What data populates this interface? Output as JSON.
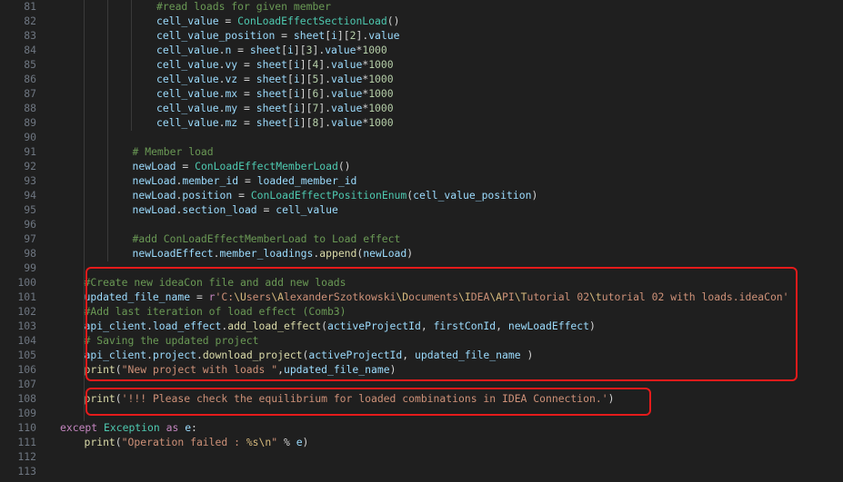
{
  "editor": {
    "lines": [
      {
        "n": "81",
        "indent": 4,
        "tokens": [
          {
            "t": "#read loads for given member",
            "c": "cmt"
          }
        ]
      },
      {
        "n": "82",
        "indent": 4,
        "tokens": [
          {
            "t": "cell_value",
            "c": "var"
          },
          {
            "t": " = ",
            "c": ""
          },
          {
            "t": "ConLoadEffectSectionLoad",
            "c": "cls"
          },
          {
            "t": "()",
            "c": ""
          }
        ]
      },
      {
        "n": "83",
        "indent": 4,
        "tokens": [
          {
            "t": "cell_value_position",
            "c": "var"
          },
          {
            "t": " = ",
            "c": ""
          },
          {
            "t": "sheet",
            "c": "var"
          },
          {
            "t": "[",
            "c": ""
          },
          {
            "t": "i",
            "c": "var"
          },
          {
            "t": "][",
            "c": ""
          },
          {
            "t": "2",
            "c": "num"
          },
          {
            "t": "].",
            "c": ""
          },
          {
            "t": "value",
            "c": "var"
          }
        ]
      },
      {
        "n": "84",
        "indent": 4,
        "tokens": [
          {
            "t": "cell_value",
            "c": "var"
          },
          {
            "t": ".",
            "c": ""
          },
          {
            "t": "n",
            "c": "var"
          },
          {
            "t": " = ",
            "c": ""
          },
          {
            "t": "sheet",
            "c": "var"
          },
          {
            "t": "[",
            "c": ""
          },
          {
            "t": "i",
            "c": "var"
          },
          {
            "t": "][",
            "c": ""
          },
          {
            "t": "3",
            "c": "num"
          },
          {
            "t": "].",
            "c": ""
          },
          {
            "t": "value",
            "c": "var"
          },
          {
            "t": "*",
            "c": ""
          },
          {
            "t": "1000",
            "c": "num"
          }
        ]
      },
      {
        "n": "85",
        "indent": 4,
        "tokens": [
          {
            "t": "cell_value",
            "c": "var"
          },
          {
            "t": ".",
            "c": ""
          },
          {
            "t": "vy",
            "c": "var"
          },
          {
            "t": " = ",
            "c": ""
          },
          {
            "t": "sheet",
            "c": "var"
          },
          {
            "t": "[",
            "c": ""
          },
          {
            "t": "i",
            "c": "var"
          },
          {
            "t": "][",
            "c": ""
          },
          {
            "t": "4",
            "c": "num"
          },
          {
            "t": "].",
            "c": ""
          },
          {
            "t": "value",
            "c": "var"
          },
          {
            "t": "*",
            "c": ""
          },
          {
            "t": "1000",
            "c": "num"
          }
        ]
      },
      {
        "n": "86",
        "indent": 4,
        "tokens": [
          {
            "t": "cell_value",
            "c": "var"
          },
          {
            "t": ".",
            "c": ""
          },
          {
            "t": "vz",
            "c": "var"
          },
          {
            "t": " = ",
            "c": ""
          },
          {
            "t": "sheet",
            "c": "var"
          },
          {
            "t": "[",
            "c": ""
          },
          {
            "t": "i",
            "c": "var"
          },
          {
            "t": "][",
            "c": ""
          },
          {
            "t": "5",
            "c": "num"
          },
          {
            "t": "].",
            "c": ""
          },
          {
            "t": "value",
            "c": "var"
          },
          {
            "t": "*",
            "c": ""
          },
          {
            "t": "1000",
            "c": "num"
          }
        ]
      },
      {
        "n": "87",
        "indent": 4,
        "tokens": [
          {
            "t": "cell_value",
            "c": "var"
          },
          {
            "t": ".",
            "c": ""
          },
          {
            "t": "mx",
            "c": "var"
          },
          {
            "t": " = ",
            "c": ""
          },
          {
            "t": "sheet",
            "c": "var"
          },
          {
            "t": "[",
            "c": ""
          },
          {
            "t": "i",
            "c": "var"
          },
          {
            "t": "][",
            "c": ""
          },
          {
            "t": "6",
            "c": "num"
          },
          {
            "t": "].",
            "c": ""
          },
          {
            "t": "value",
            "c": "var"
          },
          {
            "t": "*",
            "c": ""
          },
          {
            "t": "1000",
            "c": "num"
          }
        ]
      },
      {
        "n": "88",
        "indent": 4,
        "tokens": [
          {
            "t": "cell_value",
            "c": "var"
          },
          {
            "t": ".",
            "c": ""
          },
          {
            "t": "my",
            "c": "var"
          },
          {
            "t": " = ",
            "c": ""
          },
          {
            "t": "sheet",
            "c": "var"
          },
          {
            "t": "[",
            "c": ""
          },
          {
            "t": "i",
            "c": "var"
          },
          {
            "t": "][",
            "c": ""
          },
          {
            "t": "7",
            "c": "num"
          },
          {
            "t": "].",
            "c": ""
          },
          {
            "t": "value",
            "c": "var"
          },
          {
            "t": "*",
            "c": ""
          },
          {
            "t": "1000",
            "c": "num"
          }
        ]
      },
      {
        "n": "89",
        "indent": 4,
        "tokens": [
          {
            "t": "cell_value",
            "c": "var"
          },
          {
            "t": ".",
            "c": ""
          },
          {
            "t": "mz",
            "c": "var"
          },
          {
            "t": " = ",
            "c": ""
          },
          {
            "t": "sheet",
            "c": "var"
          },
          {
            "t": "[",
            "c": ""
          },
          {
            "t": "i",
            "c": "var"
          },
          {
            "t": "][",
            "c": ""
          },
          {
            "t": "8",
            "c": "num"
          },
          {
            "t": "].",
            "c": ""
          },
          {
            "t": "value",
            "c": "var"
          },
          {
            "t": "*",
            "c": ""
          },
          {
            "t": "1000",
            "c": "num"
          }
        ]
      },
      {
        "n": "90",
        "indent": 0,
        "tokens": []
      },
      {
        "n": "91",
        "indent": 3,
        "tokens": [
          {
            "t": "# Member load",
            "c": "cmt"
          }
        ]
      },
      {
        "n": "92",
        "indent": 3,
        "tokens": [
          {
            "t": "newLoad",
            "c": "var"
          },
          {
            "t": " = ",
            "c": ""
          },
          {
            "t": "ConLoadEffectMemberLoad",
            "c": "cls"
          },
          {
            "t": "()",
            "c": ""
          }
        ]
      },
      {
        "n": "93",
        "indent": 3,
        "tokens": [
          {
            "t": "newLoad",
            "c": "var"
          },
          {
            "t": ".",
            "c": ""
          },
          {
            "t": "member_id",
            "c": "var"
          },
          {
            "t": " = ",
            "c": ""
          },
          {
            "t": "loaded_member_id",
            "c": "var"
          }
        ]
      },
      {
        "n": "94",
        "indent": 3,
        "tokens": [
          {
            "t": "newLoad",
            "c": "var"
          },
          {
            "t": ".",
            "c": ""
          },
          {
            "t": "position",
            "c": "var"
          },
          {
            "t": " = ",
            "c": ""
          },
          {
            "t": "ConLoadEffectPositionEnum",
            "c": "cls"
          },
          {
            "t": "(",
            "c": ""
          },
          {
            "t": "cell_value_position",
            "c": "var"
          },
          {
            "t": ")",
            "c": ""
          }
        ]
      },
      {
        "n": "95",
        "indent": 3,
        "tokens": [
          {
            "t": "newLoad",
            "c": "var"
          },
          {
            "t": ".",
            "c": ""
          },
          {
            "t": "section_load",
            "c": "var"
          },
          {
            "t": " = ",
            "c": ""
          },
          {
            "t": "cell_value",
            "c": "var"
          }
        ]
      },
      {
        "n": "96",
        "indent": 0,
        "tokens": []
      },
      {
        "n": "97",
        "indent": 3,
        "tokens": [
          {
            "t": "#add ConLoadEffectMemberLoad to Load effect",
            "c": "cmt"
          }
        ]
      },
      {
        "n": "98",
        "indent": 3,
        "tokens": [
          {
            "t": "newLoadEffect",
            "c": "var"
          },
          {
            "t": ".",
            "c": ""
          },
          {
            "t": "member_loadings",
            "c": "var"
          },
          {
            "t": ".",
            "c": ""
          },
          {
            "t": "append",
            "c": "fn"
          },
          {
            "t": "(",
            "c": ""
          },
          {
            "t": "newLoad",
            "c": "var"
          },
          {
            "t": ")",
            "c": ""
          }
        ]
      },
      {
        "n": "99",
        "indent": 0,
        "tokens": []
      },
      {
        "n": "100",
        "indent": 1,
        "tokens": [
          {
            "t": "#Create new ideaCon file and add new loads",
            "c": "cmt"
          }
        ]
      },
      {
        "n": "101",
        "indent": 1,
        "tokens": [
          {
            "t": "updated_file_name",
            "c": "var"
          },
          {
            "t": " = ",
            "c": ""
          },
          {
            "t": "r",
            "c": "kw"
          },
          {
            "t": "'C:",
            "c": "str"
          },
          {
            "t": "\\U",
            "c": "esc"
          },
          {
            "t": "sers",
            "c": "str"
          },
          {
            "t": "\\A",
            "c": "esc"
          },
          {
            "t": "lexanderSzotkowski",
            "c": "str"
          },
          {
            "t": "\\D",
            "c": "esc"
          },
          {
            "t": "ocuments",
            "c": "str"
          },
          {
            "t": "\\I",
            "c": "esc"
          },
          {
            "t": "DEA",
            "c": "str"
          },
          {
            "t": "\\A",
            "c": "esc"
          },
          {
            "t": "PI",
            "c": "str"
          },
          {
            "t": "\\T",
            "c": "esc"
          },
          {
            "t": "utorial 02",
            "c": "str"
          },
          {
            "t": "\\t",
            "c": "esc"
          },
          {
            "t": "utorial 02 with loads.ideaCon'",
            "c": "str"
          }
        ]
      },
      {
        "n": "102",
        "indent": 1,
        "tokens": [
          {
            "t": "#Add last iteration of load effect (Comb3)",
            "c": "cmt"
          }
        ]
      },
      {
        "n": "103",
        "indent": 1,
        "tokens": [
          {
            "t": "api_client",
            "c": "var"
          },
          {
            "t": ".",
            "c": ""
          },
          {
            "t": "load_effect",
            "c": "var"
          },
          {
            "t": ".",
            "c": ""
          },
          {
            "t": "add_load_effect",
            "c": "fn"
          },
          {
            "t": "(",
            "c": ""
          },
          {
            "t": "activeProjectId",
            "c": "var"
          },
          {
            "t": ", ",
            "c": ""
          },
          {
            "t": "firstConId",
            "c": "var"
          },
          {
            "t": ", ",
            "c": ""
          },
          {
            "t": "newLoadEffect",
            "c": "var"
          },
          {
            "t": ")",
            "c": ""
          }
        ]
      },
      {
        "n": "104",
        "indent": 1,
        "tokens": [
          {
            "t": "# Saving the updated project",
            "c": "cmt"
          }
        ]
      },
      {
        "n": "105",
        "indent": 1,
        "tokens": [
          {
            "t": "api_client",
            "c": "var"
          },
          {
            "t": ".",
            "c": ""
          },
          {
            "t": "project",
            "c": "var"
          },
          {
            "t": ".",
            "c": ""
          },
          {
            "t": "download_project",
            "c": "fn"
          },
          {
            "t": "(",
            "c": ""
          },
          {
            "t": "activeProjectId",
            "c": "var"
          },
          {
            "t": ", ",
            "c": ""
          },
          {
            "t": "updated_file_name",
            "c": "var"
          },
          {
            "t": " )",
            "c": ""
          }
        ]
      },
      {
        "n": "106",
        "indent": 1,
        "tokens": [
          {
            "t": "print",
            "c": "fn"
          },
          {
            "t": "(",
            "c": ""
          },
          {
            "t": "\"New project with loads \"",
            "c": "str"
          },
          {
            "t": ",",
            "c": ""
          },
          {
            "t": "updated_file_name",
            "c": "var"
          },
          {
            "t": ")",
            "c": ""
          }
        ]
      },
      {
        "n": "107",
        "indent": 0,
        "tokens": []
      },
      {
        "n": "108",
        "indent": 1,
        "tokens": [
          {
            "t": "print",
            "c": "fn"
          },
          {
            "t": "(",
            "c": ""
          },
          {
            "t": "'!!! Please check the equilibrium for loaded combinations in IDEA Connection.'",
            "c": "str"
          },
          {
            "t": ")",
            "c": ""
          }
        ]
      },
      {
        "n": "109",
        "indent": 0,
        "tokens": []
      },
      {
        "n": "110",
        "indent": 0,
        "tokens": [
          {
            "t": "except",
            "c": "kw"
          },
          {
            "t": " ",
            "c": ""
          },
          {
            "t": "Exception",
            "c": "cls"
          },
          {
            "t": " ",
            "c": ""
          },
          {
            "t": "as",
            "c": "kw"
          },
          {
            "t": " ",
            "c": ""
          },
          {
            "t": "e",
            "c": "var"
          },
          {
            "t": ":",
            "c": ""
          }
        ]
      },
      {
        "n": "111",
        "indent": 1,
        "tokens": [
          {
            "t": "print",
            "c": "fn"
          },
          {
            "t": "(",
            "c": ""
          },
          {
            "t": "\"Operation failed : ",
            "c": "str"
          },
          {
            "t": "%s",
            "c": "esc"
          },
          {
            "t": "\\n",
            "c": "esc"
          },
          {
            "t": "\"",
            "c": "str"
          },
          {
            "t": " % ",
            "c": ""
          },
          {
            "t": "e",
            "c": "var"
          },
          {
            "t": ")",
            "c": ""
          }
        ]
      },
      {
        "n": "112",
        "indent": 0,
        "tokens": []
      },
      {
        "n": "113",
        "indent": 0,
        "tokens": []
      }
    ]
  },
  "colors": {
    "background": "#1f1f1f",
    "highlight_box": "#e51b1b"
  }
}
